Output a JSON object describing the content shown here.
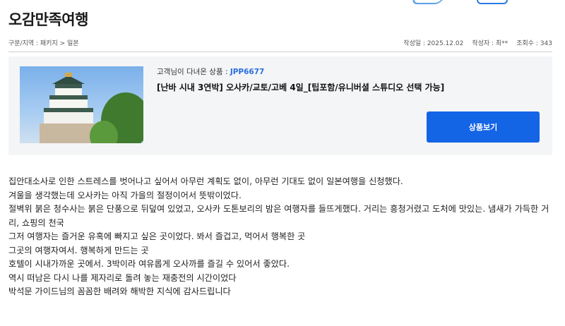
{
  "page": {
    "title": "오감만족여행"
  },
  "meta": {
    "breadcrumb": "구분/지역 : 패키지 > 일본",
    "date_label": "작성일 : 2025.12.02",
    "author_label": "작성자 : 최**",
    "views_label": "조회수 : 343"
  },
  "product": {
    "customer_label": "고객님이 다녀온 상품 : ",
    "code": "JPP6677",
    "name": "[난바 시내 3연박] 오사카/교토/고베 4일_[팁포함/유니버셜 스튜디오 선택 가능]",
    "button_label": "상품보기",
    "image_icon": "osaka-castle-photo"
  },
  "review": {
    "lines": [
      "집안대소사로 인한 스트레스를 벗어나고 싶어서 아무런 계획도 없이, 아무런 기대도 없이  일본여행을 신청했다.",
      "겨울을 생각했는데 오사카는 아직 가을의 절정이어서 뜻밖이었다.",
      "절벽위 붉은 청수사는 붉은 단풍으로 뒤덮여 있었고, 오사카 도톤보리의 밤은 여행자를 들뜨게했다. 거리는 흥청거렸고 도처에 맛있는. 냄새가 가득한 거리,  쇼핑의 천국",
      "그저 여행자는 즐거운 유혹에 빠지고 싶은 곳이었다.  봐서 즐겁고, 먹어서 행복한 곳",
      "그곳의 여행자여서. 행복하게 만드는 곳",
      "호텔이 시내가까운 곳에서. 3박이라 여유롭게 오사까를 즐길 수 있어서 좋았다.",
      "역시 떠남은 다시 나를 제자리로 돌려 놓는 재충전의 시간이었다",
      "박석문 가이드님의 꼼꼼한 배려와 해박한 지식에 감사드립니다"
    ]
  },
  "colors": {
    "accent": "#1464e6",
    "code": "#2a6fdc",
    "box_bg": "#f4f5f7"
  }
}
